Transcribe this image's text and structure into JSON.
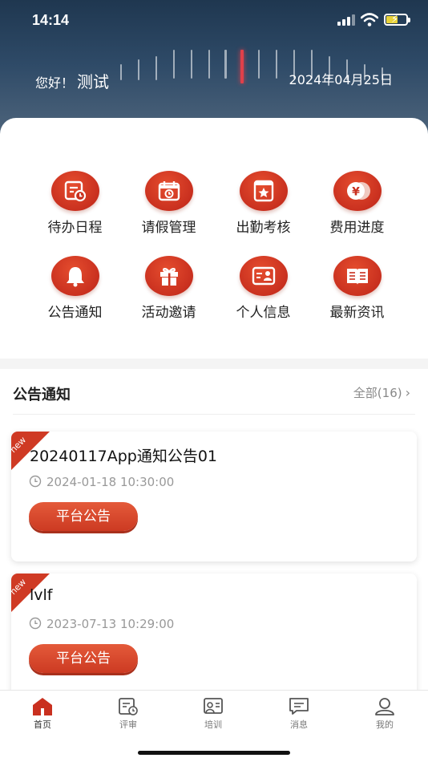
{
  "status_bar": {
    "time": "14:14"
  },
  "header": {
    "greeting": "您好！",
    "user_name": "测试",
    "date": "2024年04月25日"
  },
  "grid": [
    {
      "label": "待办日程",
      "icon": "todo-schedule-icon"
    },
    {
      "label": "请假管理",
      "icon": "leave-calendar-icon"
    },
    {
      "label": "出勤考核",
      "icon": "attendance-star-icon"
    },
    {
      "label": "费用进度",
      "icon": "yen-coin-icon"
    },
    {
      "label": "公告通知",
      "icon": "bell-icon"
    },
    {
      "label": "活动邀请",
      "icon": "gift-icon"
    },
    {
      "label": "个人信息",
      "icon": "id-card-icon"
    },
    {
      "label": "最新资讯",
      "icon": "news-book-icon"
    }
  ],
  "notices": {
    "title": "公告通知",
    "more_label": "全部(16)",
    "items": [
      {
        "badge": "new",
        "title": "20240117App通知公告01",
        "time": "2024-01-18 10:30:00",
        "tag": "平台公告"
      },
      {
        "badge": "new",
        "title": "lvlf",
        "time": "2023-07-13 10:29:00",
        "tag": "平台公告"
      }
    ]
  },
  "tabs": [
    {
      "label": "首页",
      "icon": "home-icon",
      "active": true
    },
    {
      "label": "评审",
      "icon": "review-icon",
      "active": false
    },
    {
      "label": "培训",
      "icon": "training-icon",
      "active": false
    },
    {
      "label": "消息",
      "icon": "message-icon",
      "active": false
    },
    {
      "label": "我的",
      "icon": "profile-icon",
      "active": false
    }
  ],
  "colors": {
    "accent": "#d3371f",
    "header_dark": "#1f3750"
  }
}
